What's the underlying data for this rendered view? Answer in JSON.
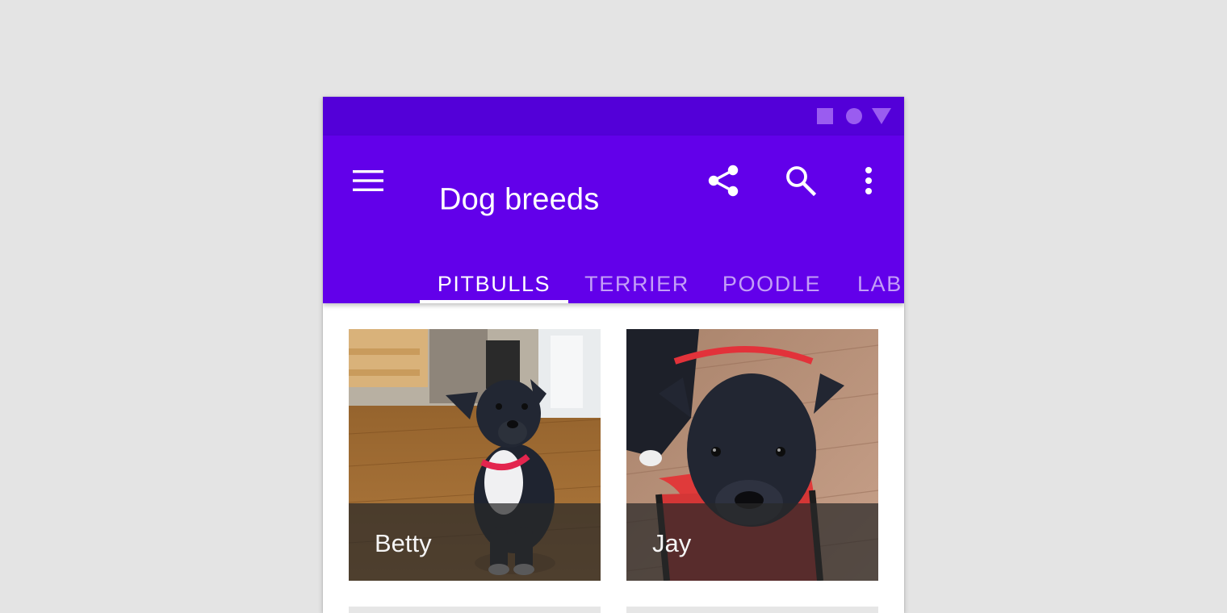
{
  "status_bar": {
    "icons": [
      "square-icon",
      "circle-icon",
      "triangle-icon"
    ],
    "icon_color": "#9a5cf0",
    "background": "#5300d8"
  },
  "app_bar": {
    "title": "Dog breeds",
    "background": "#6200ea",
    "actions": [
      "share-icon",
      "search-icon",
      "more-vert-icon"
    ],
    "navigation_icon": "menu-icon"
  },
  "tabs": {
    "items": [
      {
        "label": "PITBULLS",
        "active": true
      },
      {
        "label": "TERRIER",
        "active": false
      },
      {
        "label": "POODLE",
        "active": false
      },
      {
        "label": "LABRADOR",
        "active": false
      }
    ]
  },
  "grid": {
    "cards": [
      {
        "name": "Betty"
      },
      {
        "name": "Jay"
      }
    ]
  }
}
